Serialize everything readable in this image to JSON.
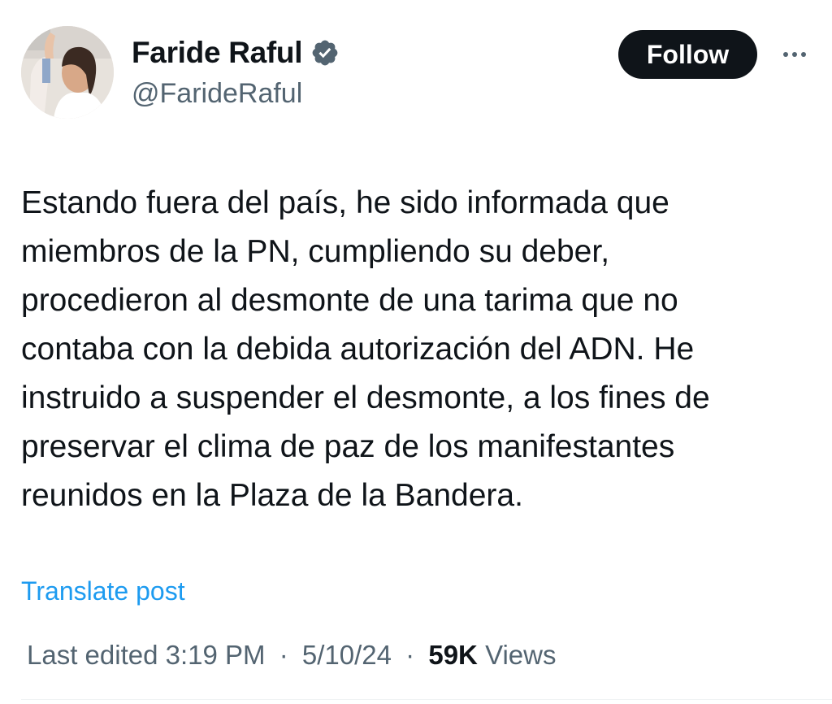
{
  "author": {
    "display_name": "Faride Raful",
    "handle": "@FarideRaful",
    "verified": true,
    "verified_color": "#1d9bf0",
    "avatar_icon": "profile-photo"
  },
  "actions": {
    "follow_label": "Follow",
    "more_icon": "ellipsis-icon"
  },
  "post": {
    "lines": [
      "Estando fuera del país, he sido informada que",
      "miembros de la PN, cumpliendo su deber,",
      "procedieron al desmonte de una tarima que no",
      "contaba con la debida autorización del ADN. He",
      "instruido a suspender el desmonte, a los fines de",
      "preservar el clima de paz de los manifestantes",
      "reunidos en la Plaza de la Bandera."
    ],
    "translate_label": "Translate post"
  },
  "meta": {
    "edited_label": "Last edited",
    "time": "3:19 PM",
    "date": "5/10/24",
    "separator": "·",
    "views_count": "59K",
    "views_label": "Views"
  },
  "colors": {
    "text_primary": "#0f1419",
    "text_secondary": "#536471",
    "accent": "#1d9bf0",
    "follow_bg": "#0f1419"
  }
}
